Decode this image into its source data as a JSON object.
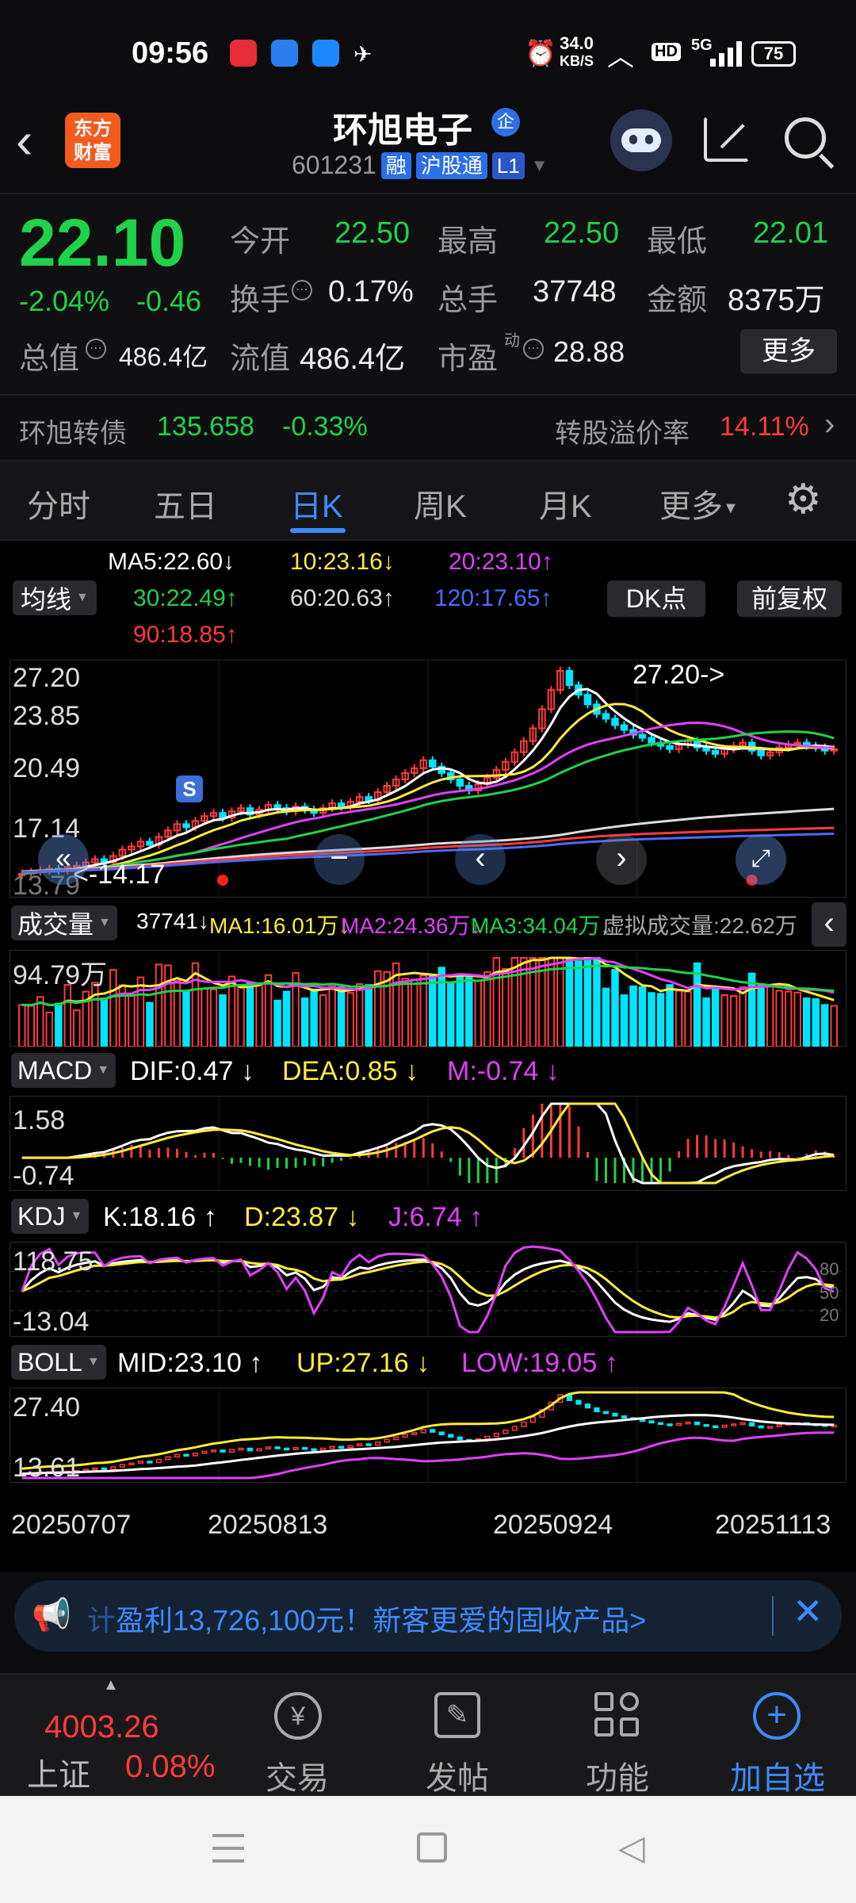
{
  "status_bar": {
    "time": "09:56",
    "net_speed_value": "34.0",
    "net_speed_unit": "KB/S",
    "hd": "HD",
    "signal": "5G",
    "battery": "75"
  },
  "header": {
    "back_icon": "chevron-left-icon",
    "logo_line1": "东方",
    "logo_line2": "财富",
    "title": "环旭电子",
    "title_badge": "企",
    "code": "601231",
    "tag_margin": "融",
    "tag_connect": "沪股通",
    "tag_level": "L1",
    "icons": [
      "robot-icon",
      "share-icon",
      "search-icon"
    ]
  },
  "quote": {
    "price": "22.10",
    "change_pct": "-2.04%",
    "change_abs": "-0.46",
    "open_label": "今开",
    "open": "22.50",
    "high_label": "最高",
    "high": "22.50",
    "low_label": "最低",
    "low": "22.01",
    "turnover_label": "换手",
    "turnover": "0.17%",
    "volume_label": "总手",
    "volume": "37748",
    "amount_label": "金额",
    "amount": "8375万",
    "mktcap_label": "总值",
    "mktcap": "486.4亿",
    "float_label": "流值",
    "float": "486.4亿",
    "pe_label": "市盈",
    "pe_sup": "动",
    "pe": "28.88",
    "more_button": "更多"
  },
  "bond": {
    "name": "环旭转债",
    "price": "135.658",
    "change": "-0.33%",
    "premium_label": "转股溢价率",
    "premium": "14.11%"
  },
  "tabs": {
    "items": [
      "分时",
      "五日",
      "日K",
      "周K",
      "月K",
      "更多"
    ],
    "active": "日K"
  },
  "ma": {
    "selector": "均线",
    "ma5": "MA5:22.60",
    "ma10": "10:23.16",
    "ma20": "20:23.10",
    "ma30": "30:22.49",
    "ma60": "60:20.63",
    "ma120": "120:17.65",
    "ma90": "90:18.85",
    "dk_button": "DK点",
    "adj_button": "前复权"
  },
  "kline": {
    "y_top": "27.20",
    "y_2": "23.85",
    "y_3": "20.49",
    "y_4": "17.14",
    "y_bottom": "13.79",
    "max_label": "27.20",
    "min_label": "14.17",
    "s_marker": "S"
  },
  "volume": {
    "selector": "成交量",
    "value": "37741",
    "ma1": "MA1:16.01万",
    "ma2": "MA2:24.36万",
    "ma3": "MA3:34.04万",
    "virtual": "虚拟成交量:22.62万",
    "y_top": "94.79万"
  },
  "macd": {
    "selector": "MACD",
    "dif": "DIF:0.47",
    "dea": "DEA:0.85",
    "m": "M:-0.74",
    "y_top": "1.58",
    "y_bottom": "-0.74"
  },
  "kdj": {
    "selector": "KDJ",
    "k": "K:18.16",
    "d": "D:23.87",
    "j": "J:6.74",
    "y_top": "118.75",
    "y_bottom": "-13.04",
    "lv80": "80",
    "lv50": "50",
    "lv20": "20"
  },
  "boll": {
    "selector": "BOLL",
    "mid": "MID:23.10",
    "up": "UP:27.16",
    "low": "LOW:19.05",
    "y_top": "27.40",
    "y_bottom": "13.61"
  },
  "dates": [
    "20250707",
    "20250813",
    "20250924",
    "20251113"
  ],
  "ad": {
    "text_prefix": "计",
    "text": "盈利13,726,100元！新客更爱的固收产品>"
  },
  "bottom_nav": {
    "index_value": "4003.26",
    "index_name": "上证",
    "index_change": "0.08%",
    "items": [
      {
        "label": "交易",
        "icon": "trade-icon"
      },
      {
        "label": "发帖",
        "icon": "edit-icon"
      },
      {
        "label": "功能",
        "icon": "grid-icon"
      },
      {
        "label": "加自选",
        "icon": "add-circle-icon"
      }
    ]
  },
  "colors": {
    "up": "#ff3b3b",
    "down": "#00e5ff",
    "green_text": "#1fd24a",
    "ma5": "#ffffff",
    "ma10": "#ffeb3b",
    "ma20": "#e040fb",
    "ma30": "#1fd24a",
    "ma60": "#dcdcdc",
    "ma120": "#4a6cff",
    "ma90": "#ff3b3b"
  },
  "chart_data": {
    "type": "candlestick",
    "x_range": [
      "20250707",
      "20251113"
    ],
    "price_axis": [
      13.79,
      27.2
    ],
    "x": [
      1,
      2,
      3,
      4,
      5,
      6,
      7,
      8,
      9,
      10,
      11,
      12,
      13,
      14,
      15,
      16,
      17,
      18,
      19,
      20,
      21,
      22,
      23,
      24,
      25,
      26,
      27,
      28,
      29,
      30,
      31,
      32,
      33,
      34,
      35,
      36,
      37,
      38,
      39,
      40,
      41,
      42,
      43,
      44,
      45,
      46,
      47,
      48,
      49,
      50,
      51,
      52,
      53,
      54,
      55,
      56,
      57,
      58,
      59,
      60,
      61,
      62,
      63,
      64,
      65,
      66,
      67,
      68,
      69,
      70,
      71,
      72,
      73,
      74,
      75,
      76,
      77,
      78,
      79,
      80,
      81,
      82,
      83,
      84,
      85,
      86,
      87,
      88,
      89,
      90
    ],
    "close": [
      14.3,
      14.4,
      14.5,
      14.6,
      14.5,
      14.7,
      14.8,
      15.0,
      15.2,
      15.0,
      15.4,
      15.8,
      16.0,
      16.3,
      16.1,
      16.6,
      17.0,
      17.4,
      17.2,
      17.6,
      17.9,
      18.1,
      17.8,
      18.2,
      18.4,
      18.0,
      18.3,
      18.6,
      18.4,
      18.2,
      18.5,
      18.3,
      18.1,
      18.4,
      18.7,
      18.5,
      18.8,
      19.1,
      18.9,
      19.4,
      19.8,
      20.2,
      20.6,
      20.9,
      21.4,
      21.0,
      20.6,
      20.2,
      19.8,
      19.5,
      19.9,
      20.3,
      20.8,
      21.3,
      21.9,
      22.6,
      23.4,
      24.6,
      25.8,
      27.0,
      26.1,
      25.5,
      24.9,
      24.3,
      24.0,
      23.6,
      23.3,
      23.0,
      22.8,
      22.5,
      22.3,
      22.1,
      22.4,
      22.6,
      22.2,
      22.0,
      21.8,
      22.1,
      22.3,
      22.5,
      22.0,
      21.7,
      21.9,
      22.2,
      22.4,
      22.5,
      22.3,
      22.2,
      22.0,
      22.1
    ],
    "volume_max": "94.79万",
    "macd_range": [
      -0.74,
      1.58
    ],
    "kdj_range": [
      -13.04,
      118.75
    ],
    "boll_range": [
      13.61,
      27.4
    ]
  }
}
